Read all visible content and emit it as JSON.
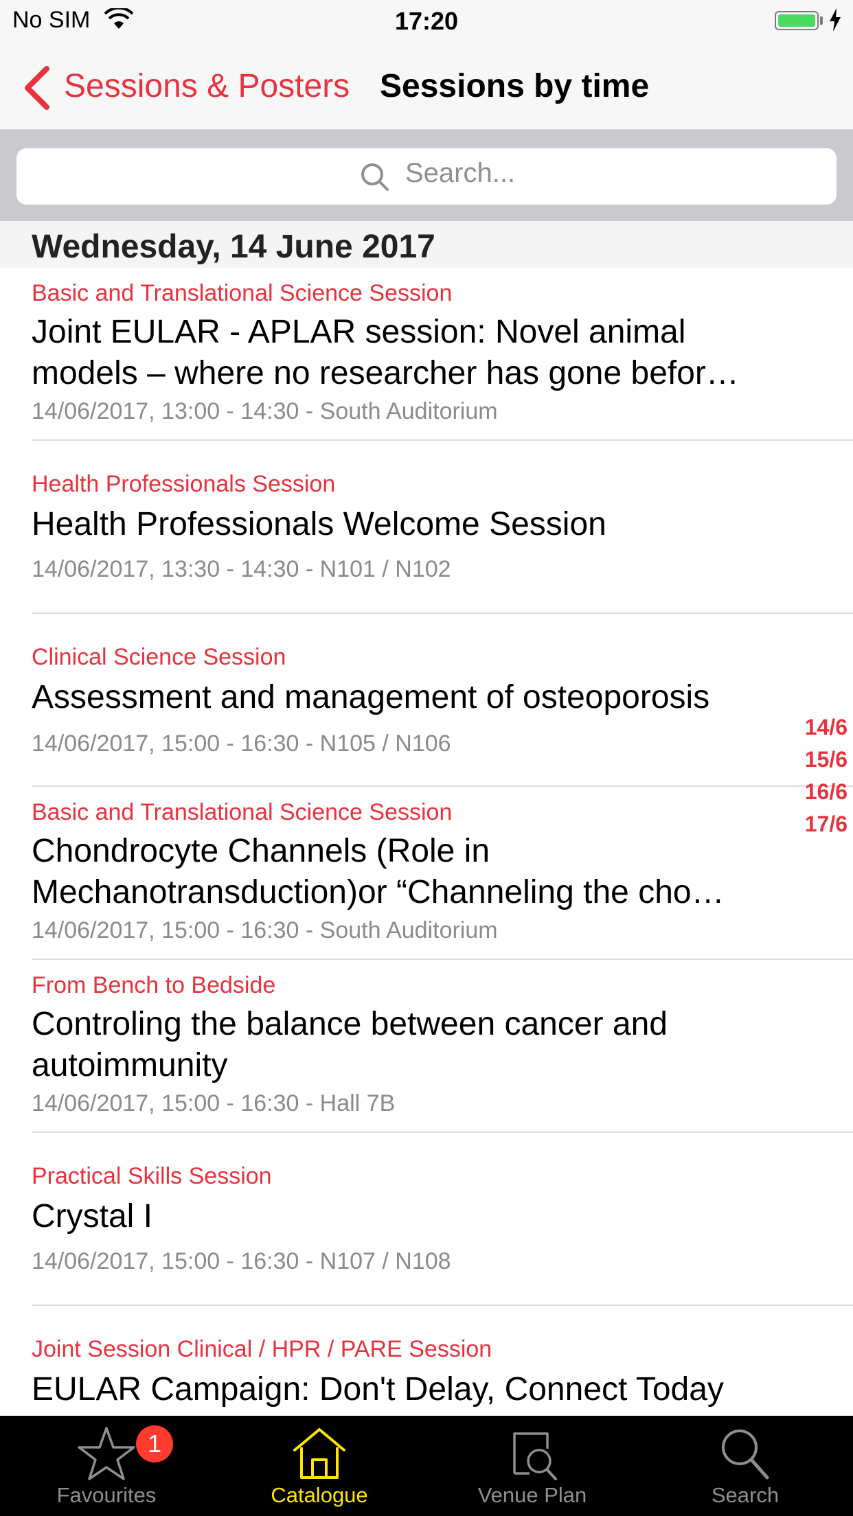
{
  "status_bar": {
    "carrier": "No SIM",
    "time": "17:20",
    "battery_color": "#4cd964"
  },
  "nav": {
    "back_label": "Sessions & Posters",
    "title": "Sessions by time"
  },
  "search": {
    "placeholder": "Search..."
  },
  "section": {
    "title": "Wednesday, 14 June 2017"
  },
  "sessions": [
    {
      "category": "Basic and Translational Science Session",
      "title": "Joint EULAR - APLAR session: Novel animal models – where no researcher has gone befor…",
      "meta": "14/06/2017, 13:00 - 14:30 - South Auditorium"
    },
    {
      "category": "Health Professionals Session",
      "title": "Health Professionals Welcome Session",
      "meta": "14/06/2017, 13:30 - 14:30 - N101 / N102"
    },
    {
      "category": "Clinical Science Session",
      "title": "Assessment and management of osteoporosis",
      "meta": "14/06/2017, 15:00 - 16:30 - N105 / N106"
    },
    {
      "category": "Basic and Translational Science Session",
      "title": "Chondrocyte Channels (Role in Mechanotransduction)or “Channeling the cho…",
      "meta": "14/06/2017, 15:00 - 16:30 - South Auditorium"
    },
    {
      "category": "From Bench to Bedside",
      "title": "Controling the balance between cancer and autoimmunity",
      "meta": "14/06/2017, 15:00 - 16:30 - Hall 7B"
    },
    {
      "category": "Practical Skills Session",
      "title": "Crystal I",
      "meta": "14/06/2017, 15:00 - 16:30 - N107 / N108"
    },
    {
      "category": "Joint Session Clinical / HPR / PARE Session",
      "title": "EULAR Campaign: Don't Delay, Connect Today",
      "meta": ""
    }
  ],
  "date_index": [
    "14/6",
    "15/6",
    "16/6",
    "17/6"
  ],
  "tabs": [
    {
      "label": "Favourites",
      "icon": "star-icon",
      "badge": "1",
      "active": false
    },
    {
      "label": "Catalogue",
      "icon": "home-icon",
      "active": true
    },
    {
      "label": "Venue Plan",
      "icon": "venue-map-icon",
      "active": false
    },
    {
      "label": "Search",
      "icon": "search-icon",
      "active": false
    }
  ],
  "colors": {
    "accent": "#e8323e",
    "tab_active": "#ffe500",
    "tab_inactive": "#8e8e93",
    "tab_bar_bg": "#000000"
  }
}
